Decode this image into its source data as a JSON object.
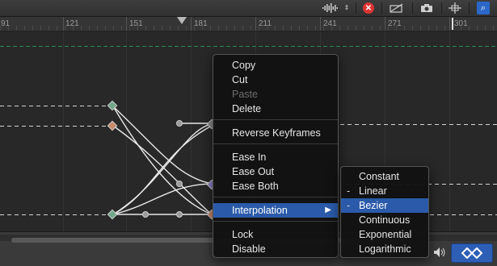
{
  "toolbar": {
    "waveform_icon": "waveform-icon",
    "record_icon": "record-icon",
    "transform_icon": "transform-icon",
    "snapshot_icon": "camera-icon",
    "fit_icon": "fit-icon",
    "search_icon": "search-icon"
  },
  "ruler": {
    "ticks": [
      "91",
      "121",
      "151",
      "181",
      "211",
      "241",
      "271",
      "301"
    ]
  },
  "context_menu": {
    "items": [
      {
        "label": "Copy",
        "enabled": true
      },
      {
        "label": "Cut",
        "enabled": true
      },
      {
        "label": "Paste",
        "enabled": false
      },
      {
        "label": "Delete",
        "enabled": true
      },
      {
        "label": "Reverse Keyframes",
        "enabled": true
      },
      {
        "label": "Ease In",
        "enabled": true
      },
      {
        "label": "Ease Out",
        "enabled": true
      },
      {
        "label": "Ease Both",
        "enabled": true
      },
      {
        "label": "Interpolation",
        "enabled": true,
        "highlighted": true,
        "submenu": true
      },
      {
        "label": "Lock",
        "enabled": true
      },
      {
        "label": "Disable",
        "enabled": true
      }
    ],
    "submenu_arrow": "▶"
  },
  "interpolation_submenu": {
    "items": [
      {
        "label": "Constant",
        "mark": ""
      },
      {
        "label": "Linear",
        "mark": "-"
      },
      {
        "label": "Bezier",
        "mark": "-",
        "highlighted": true
      },
      {
        "label": "Continuous",
        "mark": ""
      },
      {
        "label": "Exponential",
        "mark": ""
      },
      {
        "label": "Logarithmic",
        "mark": ""
      }
    ]
  },
  "colors": {
    "accent": "#2a5aa9",
    "keyframe_green": "#6fa88a",
    "keyframe_orange": "#c98a6a",
    "keyframe_purple": "#8a7fc4",
    "curve": "#e8e8e8",
    "guide_green": "#2f8a4f"
  },
  "bottom": {
    "speaker_icon": "speaker-icon",
    "keyframe_toggle_icon": "keyframe-toggle-icon"
  }
}
